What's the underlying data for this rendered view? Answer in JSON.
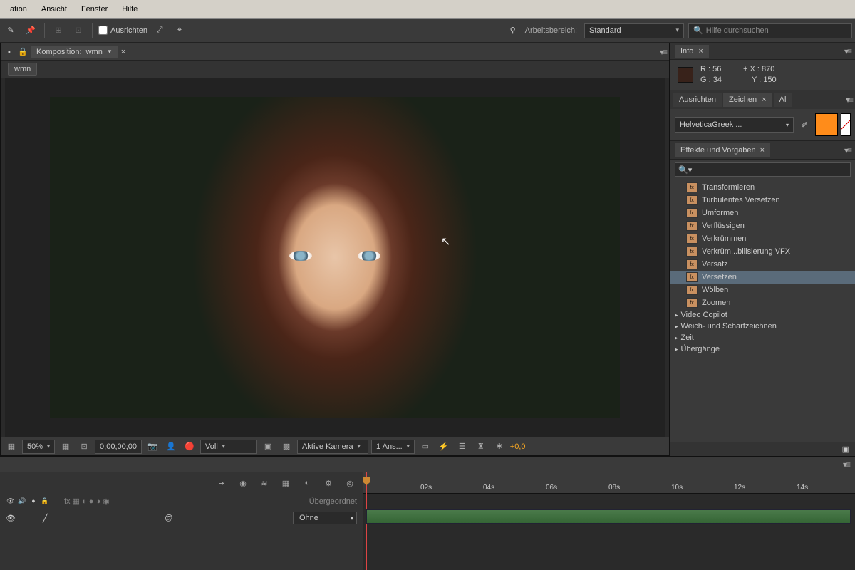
{
  "menu": {
    "items": [
      "ation",
      "Ansicht",
      "Fenster",
      "Hilfe"
    ]
  },
  "toolbar": {
    "align_label": "Ausrichten",
    "workspace_prefix": "Arbeitsbereich:",
    "workspace_value": "Standard",
    "search_placeholder": "Hilfe durchsuchen"
  },
  "composition": {
    "tab_prefix": "Komposition:",
    "tab_name": "wmn",
    "breadcrumb": "wmn"
  },
  "viewer_footer": {
    "zoom": "50%",
    "timecode": "0;00;00;00",
    "resolution": "Voll",
    "camera": "Aktive Kamera",
    "views": "1 Ans...",
    "exposure": "+0,0"
  },
  "info": {
    "title": "Info",
    "r_label": "R :",
    "r_val": "56",
    "g_label": "G :",
    "g_val": "34",
    "x_label": "X :",
    "x_val": "870",
    "y_label": "Y :",
    "y_val": "150"
  },
  "char": {
    "tabs": [
      "Ausrichten",
      "Zeichen",
      "Al"
    ],
    "font": "HelveticaGreek ..."
  },
  "effects": {
    "title": "Effekte und Vorgaben",
    "items": [
      "Transformieren",
      "Turbulentes Versetzen",
      "Umformen",
      "Verflüssigen",
      "Verkrümmen",
      "Verkrüm...bilisierung VFX",
      "Versatz",
      "Versetzen",
      "Wölben",
      "Zoomen"
    ],
    "selected_index": 7,
    "categories": [
      "Video Copilot",
      "Weich- und Scharfzeichnen",
      "Zeit",
      "Übergänge"
    ]
  },
  "timeline": {
    "parent_header": "Übergeordnet",
    "parent_value": "Ohne",
    "ticks": [
      "02s",
      "04s",
      "06s",
      "08s",
      "10s",
      "12s",
      "14s"
    ]
  }
}
